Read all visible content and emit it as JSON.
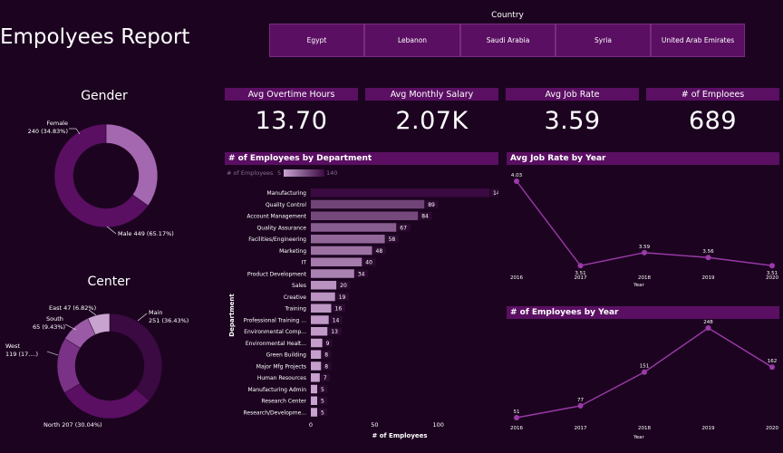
{
  "report": {
    "title": "Empolyees Report"
  },
  "country_slicer": {
    "title": "Country",
    "options": [
      "Egypt",
      "Lebanon",
      "Saudi Arabia",
      "Syria",
      "United Arab Emirates"
    ]
  },
  "gender": {
    "title": "Gender",
    "segments": [
      {
        "label_line1": "Female",
        "label_line2": "240 (34.83%)",
        "value": 240,
        "color": "#a468b0"
      },
      {
        "label_line1": "Male 449 (65.17%)",
        "label_line2": "",
        "value": 449,
        "color": "#5a0f62"
      }
    ]
  },
  "center": {
    "title": "Center",
    "segments": [
      {
        "label_line1": "Main",
        "label_line2": "251 (36.43%)",
        "value": 251,
        "color": "#3b0a42"
      },
      {
        "label_line1": "North 207 (30.04%)",
        "label_line2": "",
        "value": 207,
        "color": "#5a0f62"
      },
      {
        "label_line1": "West",
        "label_line2": "119 (17....)",
        "value": 119,
        "color": "#7a3286"
      },
      {
        "label_line1": "South",
        "label_line2": "65 (9.43%)",
        "value": 65,
        "color": "#9a5aa6"
      },
      {
        "label_line1": "East 47 (6.82%)",
        "label_line2": "",
        "value": 47,
        "color": "#c9a3d0"
      }
    ]
  },
  "kpis": [
    {
      "label": "Avg Overtime Hours",
      "value": "13.70"
    },
    {
      "label": "Avg Monthly Salary",
      "value": "2.07K"
    },
    {
      "label": "Avg Job Rate",
      "value": "3.59"
    },
    {
      "label": "# of Emploees",
      "value": "689"
    }
  ],
  "dept_chart": {
    "title": "# of Employees by Department",
    "legend_label": "# of Employees",
    "legend_min": "5",
    "legend_max": "140",
    "ylabel": "Department",
    "xlabel": "# of Employees",
    "x_ticks": [
      "0",
      "50",
      "100"
    ],
    "color_low": "#c9a3d0",
    "color_high": "#3b0a42"
  },
  "chart_data": [
    {
      "type": "bar",
      "title": "# of Employees by Department",
      "xlabel": "# of Employees",
      "ylabel": "Department",
      "categories": [
        "Manufacturing",
        "Quality Control",
        "Account Management",
        "Quality Assurance",
        "Facilities/Engineering",
        "Marketing",
        "IT",
        "Product Development",
        "Sales",
        "Creative",
        "Training",
        "Professional Training ...",
        "Environmental Comp...",
        "Environmental Healt...",
        "Green Building",
        "Major Mfg Projects",
        "Human Resources",
        "Manufacturing Admin",
        "Research Center",
        "Research/Developme..."
      ],
      "values": [
        140,
        89,
        84,
        67,
        58,
        48,
        40,
        34,
        20,
        19,
        16,
        14,
        13,
        9,
        8,
        8,
        7,
        5,
        5,
        5
      ],
      "xlim": [
        0,
        140
      ]
    },
    {
      "type": "line",
      "title": "Avg Job Rate by Year",
      "xlabel": "Year",
      "x": [
        "2016",
        "2017",
        "2018",
        "2019",
        "2020"
      ],
      "values": [
        4.03,
        3.51,
        3.59,
        3.56,
        3.51
      ],
      "value_labels": [
        "4.03",
        "3.51",
        "3.59",
        "3.56",
        "3.51"
      ],
      "ylim": [
        3.5,
        4.03
      ]
    },
    {
      "type": "line",
      "title": "# of Employees by Year",
      "xlabel": "Year",
      "x": [
        "2016",
        "2017",
        "2018",
        "2019",
        "2020"
      ],
      "values": [
        51,
        77,
        151,
        248,
        162
      ],
      "value_labels": [
        "51",
        "77",
        "151",
        "248",
        "162"
      ],
      "ylim": [
        51,
        248
      ]
    }
  ],
  "colors": {
    "background": "#1c0420",
    "panel_header": "#5a0f62",
    "line": "#9b3aa8"
  }
}
